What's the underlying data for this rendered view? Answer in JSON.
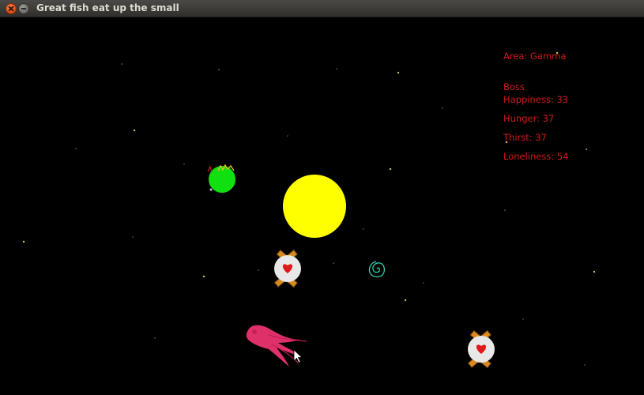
{
  "window": {
    "title": "Great fish eat up the small"
  },
  "hud": {
    "area": "Area: Gamma",
    "boss_label": "Boss",
    "happiness": "Happiness: 33",
    "hunger": "Hunger: 37",
    "thirst": "Thirst: 37",
    "loneliness": "Loneliness: 54"
  },
  "colors": {
    "hud_text": "#d11a1a",
    "sun": "#ffff00",
    "green_planet": "#10e010",
    "squid": "#e0306a",
    "spiral": "#2fd0b0",
    "space_station": "#e8e8e8",
    "heart": "#e01818",
    "star": "#c8c860"
  },
  "icons": {
    "close": "close-icon",
    "minimize": "minimize-icon",
    "cursor": "mouse-cursor-icon"
  }
}
